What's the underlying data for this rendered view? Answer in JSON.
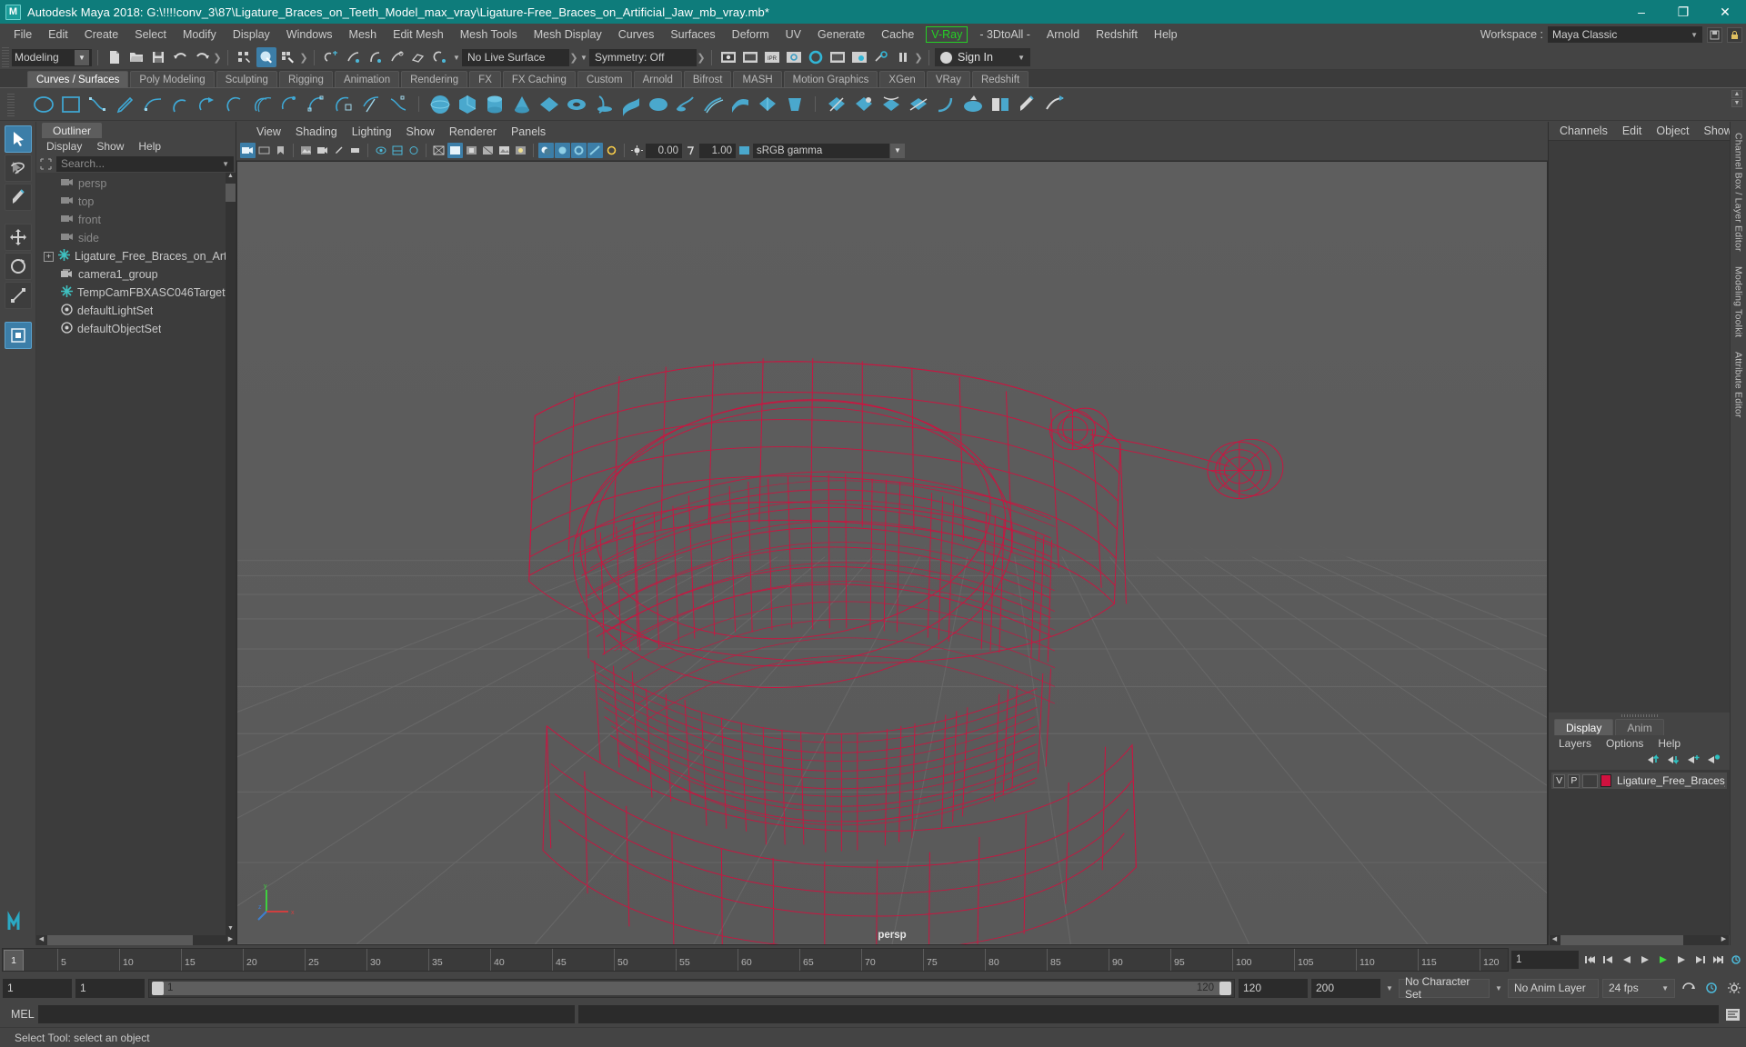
{
  "window": {
    "title": "Autodesk Maya 2018: G:\\!!!!conv_3\\87\\Ligature_Braces_on_Teeth_Model_max_vray\\Ligature-Free_Braces_on_Artificial_Jaw_mb_vray.mb*",
    "logo": "M",
    "minimize": "–",
    "maximize": "❐",
    "close": "✕"
  },
  "menubar": {
    "items": [
      {
        "label": "File"
      },
      {
        "label": "Edit"
      },
      {
        "label": "Create"
      },
      {
        "label": "Select"
      },
      {
        "label": "Modify"
      },
      {
        "label": "Display"
      },
      {
        "label": "Windows"
      },
      {
        "label": "Mesh"
      },
      {
        "label": "Edit Mesh"
      },
      {
        "label": "Mesh Tools"
      },
      {
        "label": "Mesh Display"
      },
      {
        "label": "Curves"
      },
      {
        "label": "Surfaces"
      },
      {
        "label": "Deform"
      },
      {
        "label": "UV"
      },
      {
        "label": "Generate"
      },
      {
        "label": "Cache"
      },
      {
        "label": "V-Ray",
        "highlight": true
      },
      {
        "label": "- 3DtoAll -"
      },
      {
        "label": "Arnold"
      },
      {
        "label": "Redshift"
      },
      {
        "label": "Help"
      }
    ],
    "workspace_label": "Workspace :",
    "workspace_value": "Maya Classic",
    "accent_green": "#25d025"
  },
  "statusline": {
    "mode": "Modeling",
    "live_surface": "No Live Surface",
    "symmetry": "Symmetry: Off",
    "signin": "Sign In"
  },
  "shelf": {
    "tabs": [
      "Curves / Surfaces",
      "Poly Modeling",
      "Sculpting",
      "Rigging",
      "Animation",
      "Rendering",
      "FX",
      "FX Caching",
      "Custom",
      "Arnold",
      "Bifrost",
      "MASH",
      "Motion Graphics",
      "XGen",
      "VRay",
      "Redshift"
    ],
    "selected_tab": "Curves / Surfaces"
  },
  "outliner": {
    "tab": "Outliner",
    "menus": [
      "Display",
      "Show",
      "Help"
    ],
    "search_placeholder": "Search...",
    "items": [
      {
        "label": "persp",
        "icon": "camera-icon",
        "dim": true,
        "indent": 1
      },
      {
        "label": "top",
        "icon": "camera-icon",
        "dim": true,
        "indent": 1
      },
      {
        "label": "front",
        "icon": "camera-icon",
        "dim": true,
        "indent": 1
      },
      {
        "label": "side",
        "icon": "camera-icon",
        "dim": true,
        "indent": 1
      },
      {
        "label": "Ligature_Free_Braces_on_Artificial_Jaw",
        "icon": "transform-icon",
        "dim": false,
        "indent": 0,
        "expandable": true
      },
      {
        "label": "camera1_group",
        "icon": "camera-group-icon",
        "dim": false,
        "indent": 1
      },
      {
        "label": "TempCamFBXASC046Target",
        "icon": "transform-icon",
        "dim": false,
        "indent": 1
      },
      {
        "label": "defaultLightSet",
        "icon": "set-icon",
        "dim": false,
        "indent": 1
      },
      {
        "label": "defaultObjectSet",
        "icon": "set-icon",
        "dim": false,
        "indent": 1
      }
    ]
  },
  "viewport": {
    "menus": [
      "View",
      "Shading",
      "Lighting",
      "Show",
      "Renderer",
      "Panels"
    ],
    "exposure": "0.00",
    "gamma_value": "1.00",
    "color_space": "sRGB gamma",
    "camera_label": "persp",
    "axis": {
      "x": "x",
      "y": "y",
      "z": "z"
    },
    "model_color": "#d1113f",
    "bg_color": "#5c5c5c"
  },
  "right_panel": {
    "tabs": [
      "Channels",
      "Edit",
      "Object",
      "Show"
    ],
    "vertical_tabs": [
      "Channel Box / Layer Editor",
      "Modeling Toolkit",
      "Attribute Editor"
    ]
  },
  "layer_editor": {
    "tabs": [
      "Display",
      "Anim"
    ],
    "selected_tab": "Display",
    "menus": [
      "Layers",
      "Options",
      "Help"
    ],
    "rows": [
      {
        "visibility": "V",
        "playback": "P",
        "shading": "",
        "color": "#d1113f",
        "name": "Ligature_Free_Braces_on_Artifi"
      }
    ]
  },
  "time_slider": {
    "current_frame": "1",
    "ticks": [
      "5",
      "10",
      "15",
      "20",
      "25",
      "30",
      "35",
      "40",
      "45",
      "50",
      "55",
      "60",
      "65",
      "70",
      "75",
      "80",
      "85",
      "90",
      "95",
      "100",
      "105",
      "110",
      "115",
      "120"
    ],
    "end_field": "1"
  },
  "range_slider": {
    "start": "1",
    "anim_start": "1",
    "range_start_label": "1",
    "range_end_label": "120",
    "anim_end": "120",
    "end": "200",
    "character_set": "No Character Set",
    "anim_layer": "No Anim Layer",
    "fps": "24 fps"
  },
  "command_line": {
    "label": "MEL",
    "input_value": "",
    "output_value": ""
  },
  "help_line": {
    "text": "Select Tool: select an object"
  }
}
